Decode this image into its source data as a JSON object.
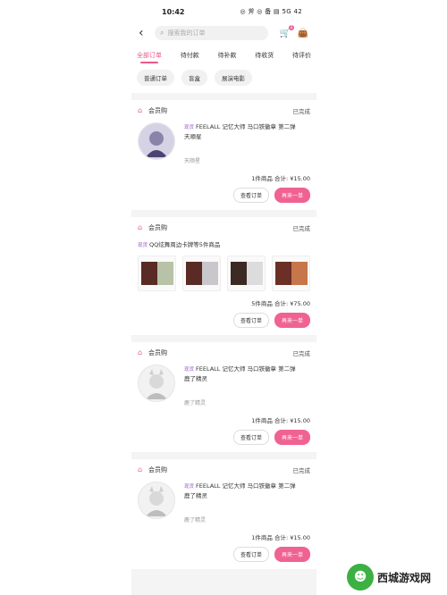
{
  "status_bar": {
    "time": "10:42",
    "icons": "◎ 斧 ◎ 备 ▤ 5G 42"
  },
  "header": {
    "search_placeholder": "搜索我的订单",
    "cart_badge": "1"
  },
  "tabs": [
    {
      "label": "全部订单",
      "active": true
    },
    {
      "label": "待付款",
      "active": false
    },
    {
      "label": "待补款",
      "active": false
    },
    {
      "label": "待收货",
      "active": false
    },
    {
      "label": "待评价",
      "active": false
    }
  ],
  "filters": [
    "普通订单",
    "盲盒",
    "展演电影"
  ],
  "orders": [
    {
      "shop": "会员购",
      "status": "已完成",
      "tag": "现货",
      "title": "FEELALL 记忆大师 马口铁徽章 第二弹",
      "title2": "天顺星",
      "spec": "天顺星",
      "total": "1件商品 合计: ¥15.00",
      "btn1": "查看订单",
      "btn2": "再来一单"
    },
    {
      "shop": "会员购",
      "status": "已完成",
      "multi_title": "QQ炫舞周边卡牌等5件商品",
      "tag": "现货",
      "total": "5件商品 合计: ¥75.00",
      "btn1": "查看订单",
      "btn2": "再来一单"
    },
    {
      "shop": "会员购",
      "status": "已完成",
      "tag": "现货",
      "title": "FEELALL 记忆大师 马口铁徽章 第二弹",
      "title2": "鹿了精灵",
      "spec": "鹿了精灵",
      "total": "1件商品 合计: ¥15.00",
      "btn1": "查看订单",
      "btn2": "再来一单"
    },
    {
      "shop": "会员购",
      "status": "已完成",
      "tag": "现货",
      "title": "FEELALL 记忆大师 马口铁徽章 第二弹",
      "title2": "鹿了精灵",
      "spec": "鹿了精灵",
      "total": "1件商品 合计: ¥15.00",
      "btn1": "查看订单",
      "btn2": "再来一单"
    }
  ],
  "watermark": {
    "text": "西城游戏网",
    "logo_icon": "game-logo-icon"
  }
}
